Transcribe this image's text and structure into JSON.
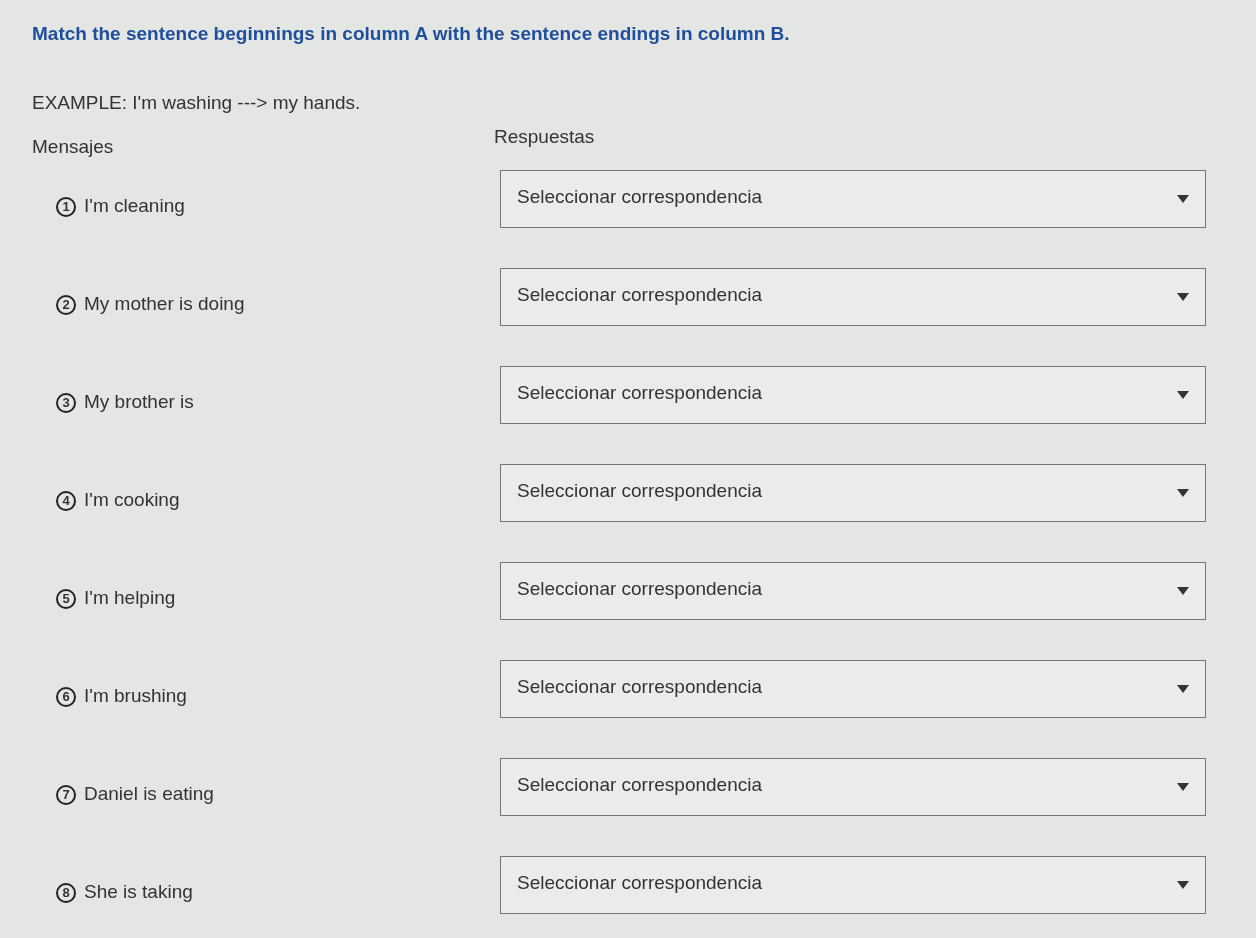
{
  "instruction": "Match the sentence beginnings in column A with the sentence endings in column B.",
  "example": "EXAMPLE: I'm washing ---> my hands.",
  "columns": {
    "left": "Mensajes",
    "right": "Respuestas"
  },
  "items": [
    {
      "number": "1",
      "prompt": "I'm cleaning",
      "placeholder": "Seleccionar correspondencia"
    },
    {
      "number": "2",
      "prompt": "My mother is doing",
      "placeholder": "Seleccionar correspondencia"
    },
    {
      "number": "3",
      "prompt": "My brother is",
      "placeholder": "Seleccionar correspondencia"
    },
    {
      "number": "4",
      "prompt": "I'm cooking",
      "placeholder": "Seleccionar correspondencia"
    },
    {
      "number": "5",
      "prompt": "I'm helping",
      "placeholder": "Seleccionar correspondencia"
    },
    {
      "number": "6",
      "prompt": "I'm brushing",
      "placeholder": "Seleccionar correspondencia"
    },
    {
      "number": "7",
      "prompt": "Daniel is eating",
      "placeholder": "Seleccionar correspondencia"
    },
    {
      "number": "8",
      "prompt": "She is taking",
      "placeholder": "Seleccionar correspondencia"
    }
  ]
}
